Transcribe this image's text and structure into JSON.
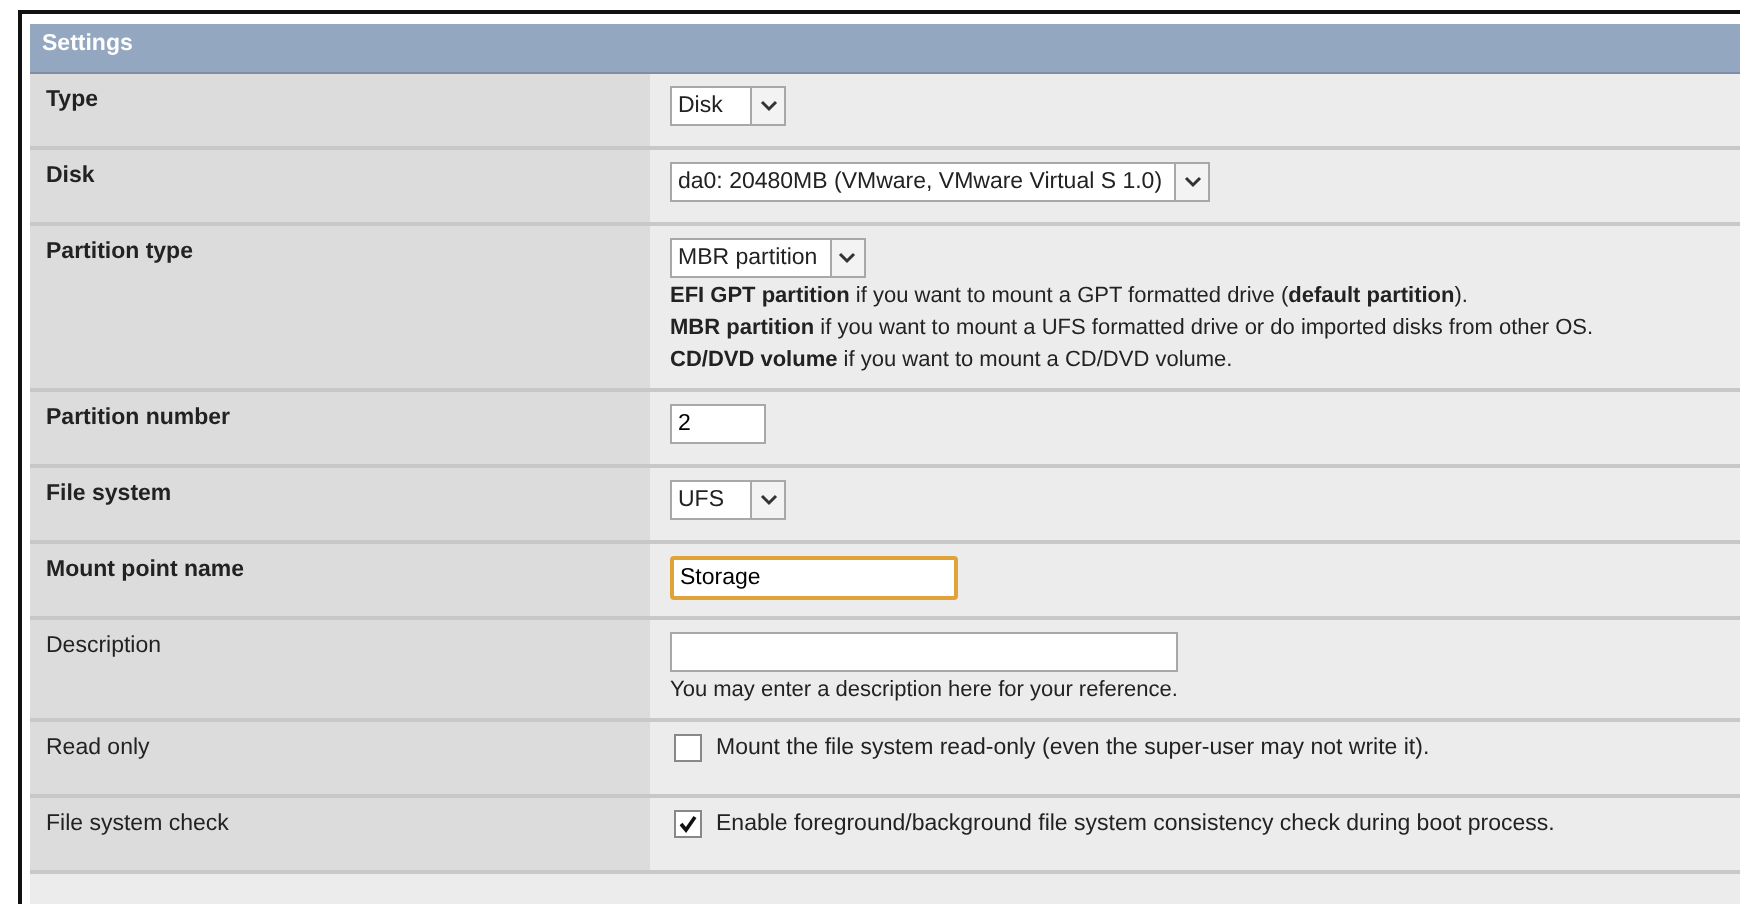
{
  "panel": {
    "title": "Settings"
  },
  "rows": [
    {
      "label": "Type",
      "required": true,
      "kind": "select",
      "value": "Disk"
    },
    {
      "label": "Disk",
      "required": true,
      "kind": "select",
      "value": "da0: 20480MB (VMware, VMware Virtual S 1.0)"
    },
    {
      "label": "Partition type",
      "required": true,
      "kind": "select",
      "value": "MBR partition",
      "notes": [
        "**EFI GPT partition** if you want to mount a GPT formatted drive (**default partition**).",
        "**MBR partition** if you want to mount a UFS formatted drive or do imported disks from other OS.",
        "**CD/DVD volume** if you want to mount a CD/DVD volume."
      ]
    },
    {
      "label": "Partition number",
      "required": true,
      "kind": "input",
      "value": "2",
      "focused": false
    },
    {
      "label": "File system",
      "required": true,
      "kind": "select",
      "value": "UFS"
    },
    {
      "label": "Mount point name",
      "required": true,
      "kind": "input",
      "value": "Storage",
      "focused": true
    },
    {
      "label": "Description",
      "required": false,
      "kind": "input",
      "value": "",
      "focused": false,
      "notes": [
        "You may enter a description here for your reference."
      ]
    },
    {
      "label": "Read only",
      "required": false,
      "kind": "checkbox",
      "checked": false,
      "text": "Mount the file system read-only (even the super-user may not write it)."
    },
    {
      "label": "File system check",
      "required": false,
      "kind": "checkbox",
      "checked": true,
      "text": "Enable foreground/background file system consistency check during boot process."
    }
  ]
}
